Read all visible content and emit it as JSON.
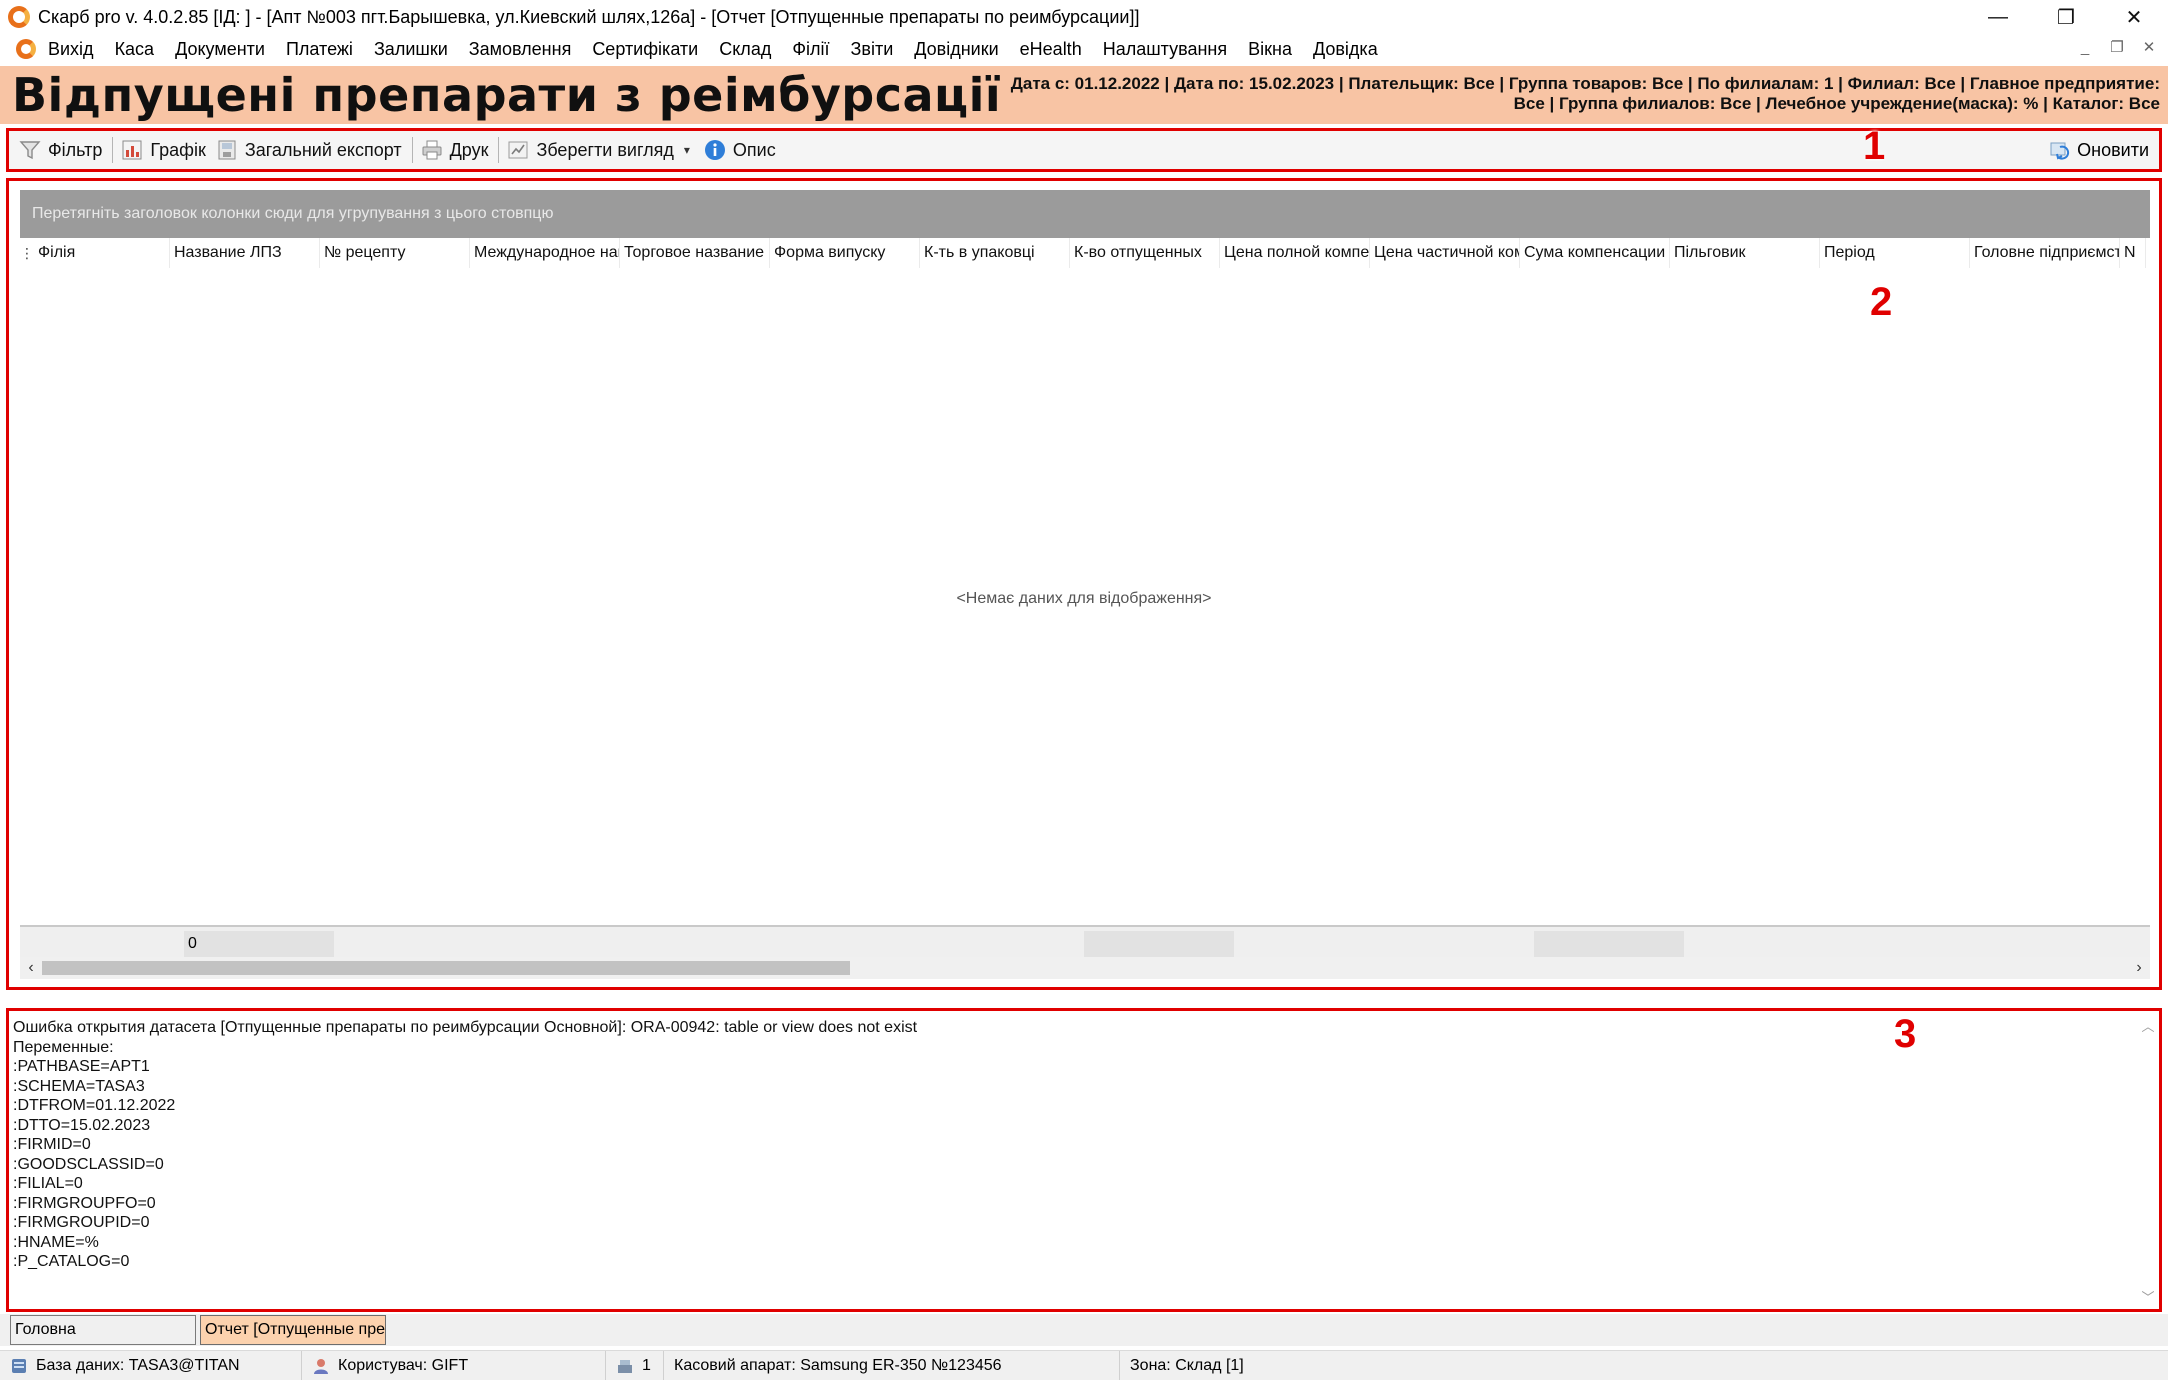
{
  "window": {
    "title": "Скарб pro v. 4.0.2.85 [ІД:       ] - [Апт №003 пгт.Барышевка, ул.Киевский шлях,126а] - [Отчет [Отпущенные препараты по реимбурсации]]",
    "minimize": "—",
    "restore": "❐",
    "close": "✕"
  },
  "menu": {
    "items": [
      "Вихід",
      "Каса",
      "Документи",
      "Платежі",
      "Залишки",
      "Замовлення",
      "Сертифікати",
      "Склад",
      "Філії",
      "Звіти",
      "Довідники",
      "eHealth",
      "Налаштування",
      "Вікна",
      "Довідка"
    ],
    "mdi_minimize": "_",
    "mdi_restore": "❐",
    "mdi_close": "✕"
  },
  "report": {
    "title": "Відпущені препарати з реімбурсації",
    "params_line1": "Дата с: 01.12.2022 | Дата по: 15.02.2023 | Плательщик: Все | Группа товаров: Все | По филиалам: 1 | Филиал: Все | Главное предприятие:",
    "params_line2": "Все | Группа филиалов: Все | Лечебное учреждение(маска): % | Каталог: Все"
  },
  "toolbar": {
    "filter": "Фільтр",
    "chart": "Графік",
    "export": "Загальний експорт",
    "print": "Друк",
    "save_view": "Зберегти вигляд",
    "dropdown": "▾",
    "description": "Опис",
    "refresh": "Оновити"
  },
  "markers": [
    "1",
    "2",
    "3"
  ],
  "grid": {
    "group_hint": "Перетягніть заголовок колонки сюди для угрупування з цього стовпцю",
    "columns": [
      "Філія",
      "Название ЛПЗ",
      "№ рецепту",
      "Международное наименование",
      "Торговое название",
      "Форма випуску",
      "К-ть в упаковці",
      "К-во отпущенных",
      "Цена полной компенсации",
      "Цена частичной компенсации",
      "Сума компенсации",
      "Пільговик",
      "Період",
      "Головне підприємство",
      "N"
    ],
    "empty_message": "<Немає даних для відображення>",
    "footer_count": "0"
  },
  "error_log": {
    "lines": [
      "Ошибка открытия датасета [Отпущенные препараты по реимбурсации Основной]: ORA-00942: table or view does not exist",
      "Переменные:",
      ":PATHBASE=APT1",
      ":SCHEMA=TASA3",
      ":DTFROM=01.12.2022",
      ":DTTO=15.02.2023",
      ":FIRMID=0",
      ":GOODSCLASSID=0",
      ":FILIAL=0",
      ":FIRMGROUPFO=0",
      ":FIRMGROUPID=0",
      ":HNAME=%",
      ":P_CATALOG=0"
    ]
  },
  "window_tabs": {
    "home": "Головна",
    "active": "Отчет [Отпущенные препараты по реимбурсации]"
  },
  "status": {
    "database": "База даних: TASA3@TITAN",
    "user": "Користувач: GIFT",
    "register_count": "1",
    "register": "Касовий апарат: Samsung ER-350 №123456",
    "zone": "Зона: Склад [1]"
  },
  "colors": {
    "accent_orange": "#e8701a",
    "header_peach": "#f8c4a4",
    "highlight_red": "#e00000",
    "active_tab": "#fcd2ae"
  }
}
